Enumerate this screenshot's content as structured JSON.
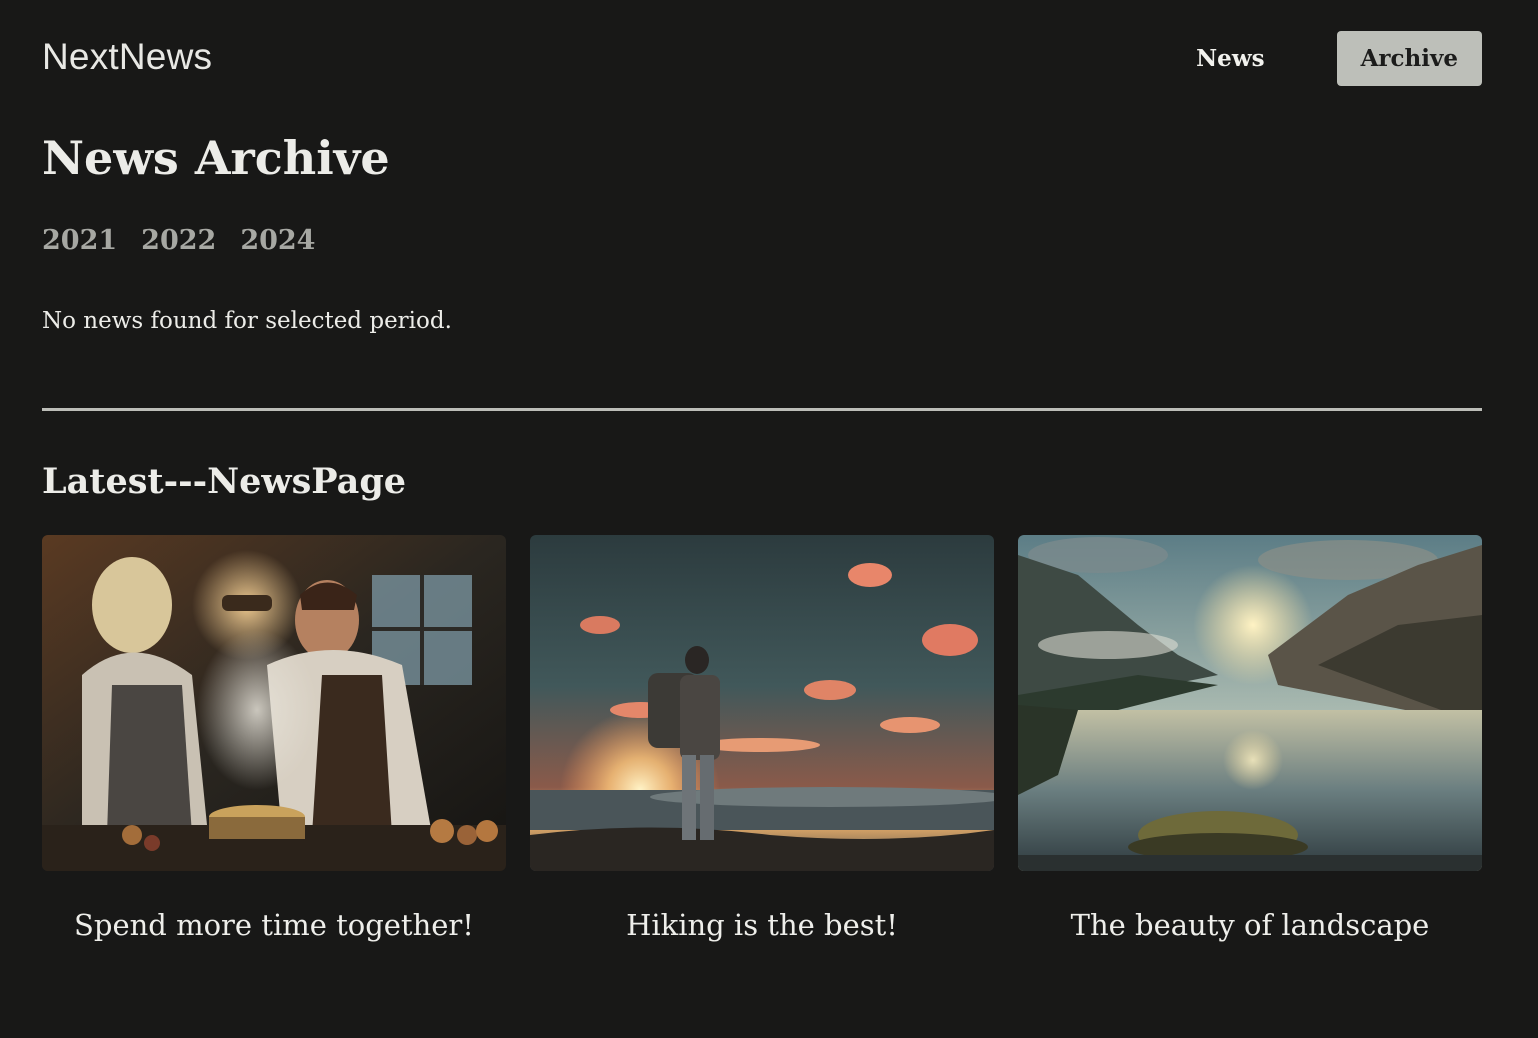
{
  "header": {
    "logo": "NextNews",
    "nav": [
      {
        "label": "News",
        "active": false
      },
      {
        "label": "Archive",
        "active": true
      }
    ]
  },
  "archive": {
    "title": "News Archive",
    "years": [
      "2021",
      "2022",
      "2024"
    ],
    "empty_message": "No news found for selected period."
  },
  "latest": {
    "heading": "Latest---NewsPage",
    "cards": [
      {
        "title": "Spend more time together!",
        "image": "couple-cooking-in-kitchen-photo"
      },
      {
        "title": "Hiking is the best!",
        "image": "hiker-watching-sunset-above-clouds-photo"
      },
      {
        "title": "The beauty of landscape",
        "image": "mountain-lake-at-sunrise-photo"
      }
    ]
  },
  "colors": {
    "background": "#181817",
    "text": "#eeeeea",
    "active_nav_bg": "#bdbfb9",
    "year_link": "#a7a8a3",
    "divider": "#bcbdb8"
  }
}
